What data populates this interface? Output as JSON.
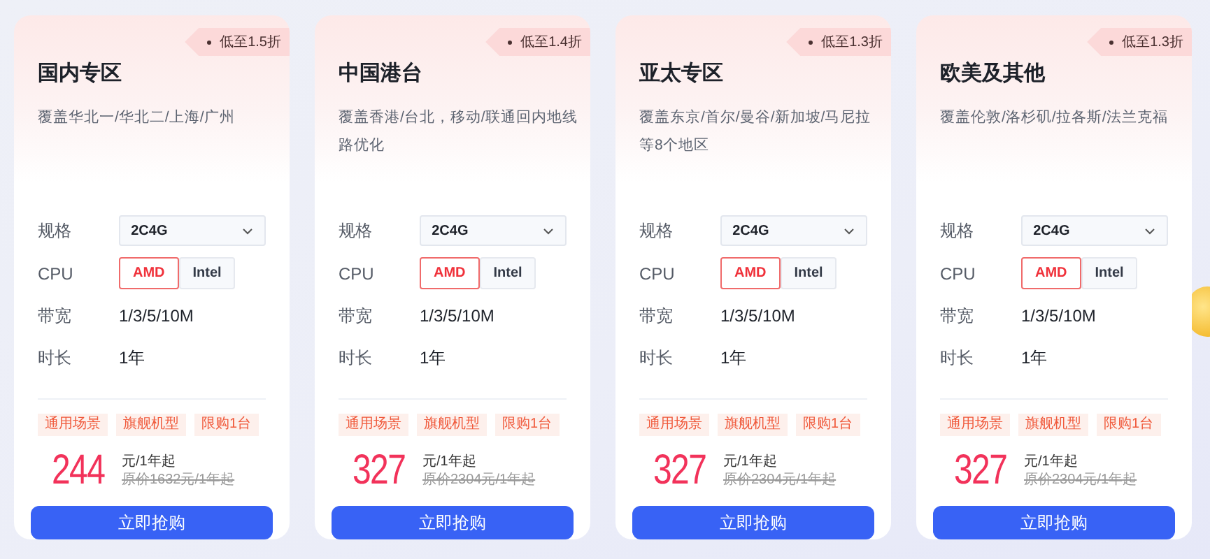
{
  "cards": [
    {
      "badge": "低至1.5折",
      "title": "国内专区",
      "description": "覆盖华北一/华北二/上海/广州",
      "spec": {
        "label": "规格",
        "value": "2C4G"
      },
      "cpu": {
        "label": "CPU",
        "options": [
          {
            "label": "AMD",
            "selected": true
          },
          {
            "label": "Intel",
            "selected": false
          }
        ]
      },
      "bandwidth": {
        "label": "带宽",
        "value": "1/3/5/10M"
      },
      "duration": {
        "label": "时长",
        "value": "1年"
      },
      "tags": [
        "通用场景",
        "旗舰机型",
        "限购1台"
      ],
      "price": "244",
      "unit": "元/1年起",
      "original_price": "原价1632元/1年起",
      "button": "立即抢购"
    },
    {
      "badge": "低至1.4折",
      "title": "中国港台",
      "description": "覆盖香港/台北，移动/联通回内地线路优化",
      "spec": {
        "label": "规格",
        "value": "2C4G"
      },
      "cpu": {
        "label": "CPU",
        "options": [
          {
            "label": "AMD",
            "selected": true
          },
          {
            "label": "Intel",
            "selected": false
          }
        ]
      },
      "bandwidth": {
        "label": "带宽",
        "value": "1/3/5/10M"
      },
      "duration": {
        "label": "时长",
        "value": "1年"
      },
      "tags": [
        "通用场景",
        "旗舰机型",
        "限购1台"
      ],
      "price": "327",
      "unit": "元/1年起",
      "original_price": "原价2304元/1年起",
      "button": "立即抢购"
    },
    {
      "badge": "低至1.3折",
      "title": "亚太专区",
      "description": "覆盖东京/首尔/曼谷/新加坡/马尼拉等8个地区",
      "spec": {
        "label": "规格",
        "value": "2C4G"
      },
      "cpu": {
        "label": "CPU",
        "options": [
          {
            "label": "AMD",
            "selected": true
          },
          {
            "label": "Intel",
            "selected": false
          }
        ]
      },
      "bandwidth": {
        "label": "带宽",
        "value": "1/3/5/10M"
      },
      "duration": {
        "label": "时长",
        "value": "1年"
      },
      "tags": [
        "通用场景",
        "旗舰机型",
        "限购1台"
      ],
      "price": "327",
      "unit": "元/1年起",
      "original_price": "原价2304元/1年起",
      "button": "立即抢购"
    },
    {
      "badge": "低至1.3折",
      "title": "欧美及其他",
      "description": "覆盖伦敦/洛杉矶/拉各斯/法兰克福",
      "spec": {
        "label": "规格",
        "value": "2C4G"
      },
      "cpu": {
        "label": "CPU",
        "options": [
          {
            "label": "AMD",
            "selected": true
          },
          {
            "label": "Intel",
            "selected": false
          }
        ]
      },
      "bandwidth": {
        "label": "带宽",
        "value": "1/3/5/10M"
      },
      "duration": {
        "label": "时长",
        "value": "1年"
      },
      "tags": [
        "通用场景",
        "旗舰机型",
        "限购1台"
      ],
      "price": "327",
      "unit": "元/1年起",
      "original_price": "原价2304元/1年起",
      "button": "立即抢购"
    }
  ]
}
